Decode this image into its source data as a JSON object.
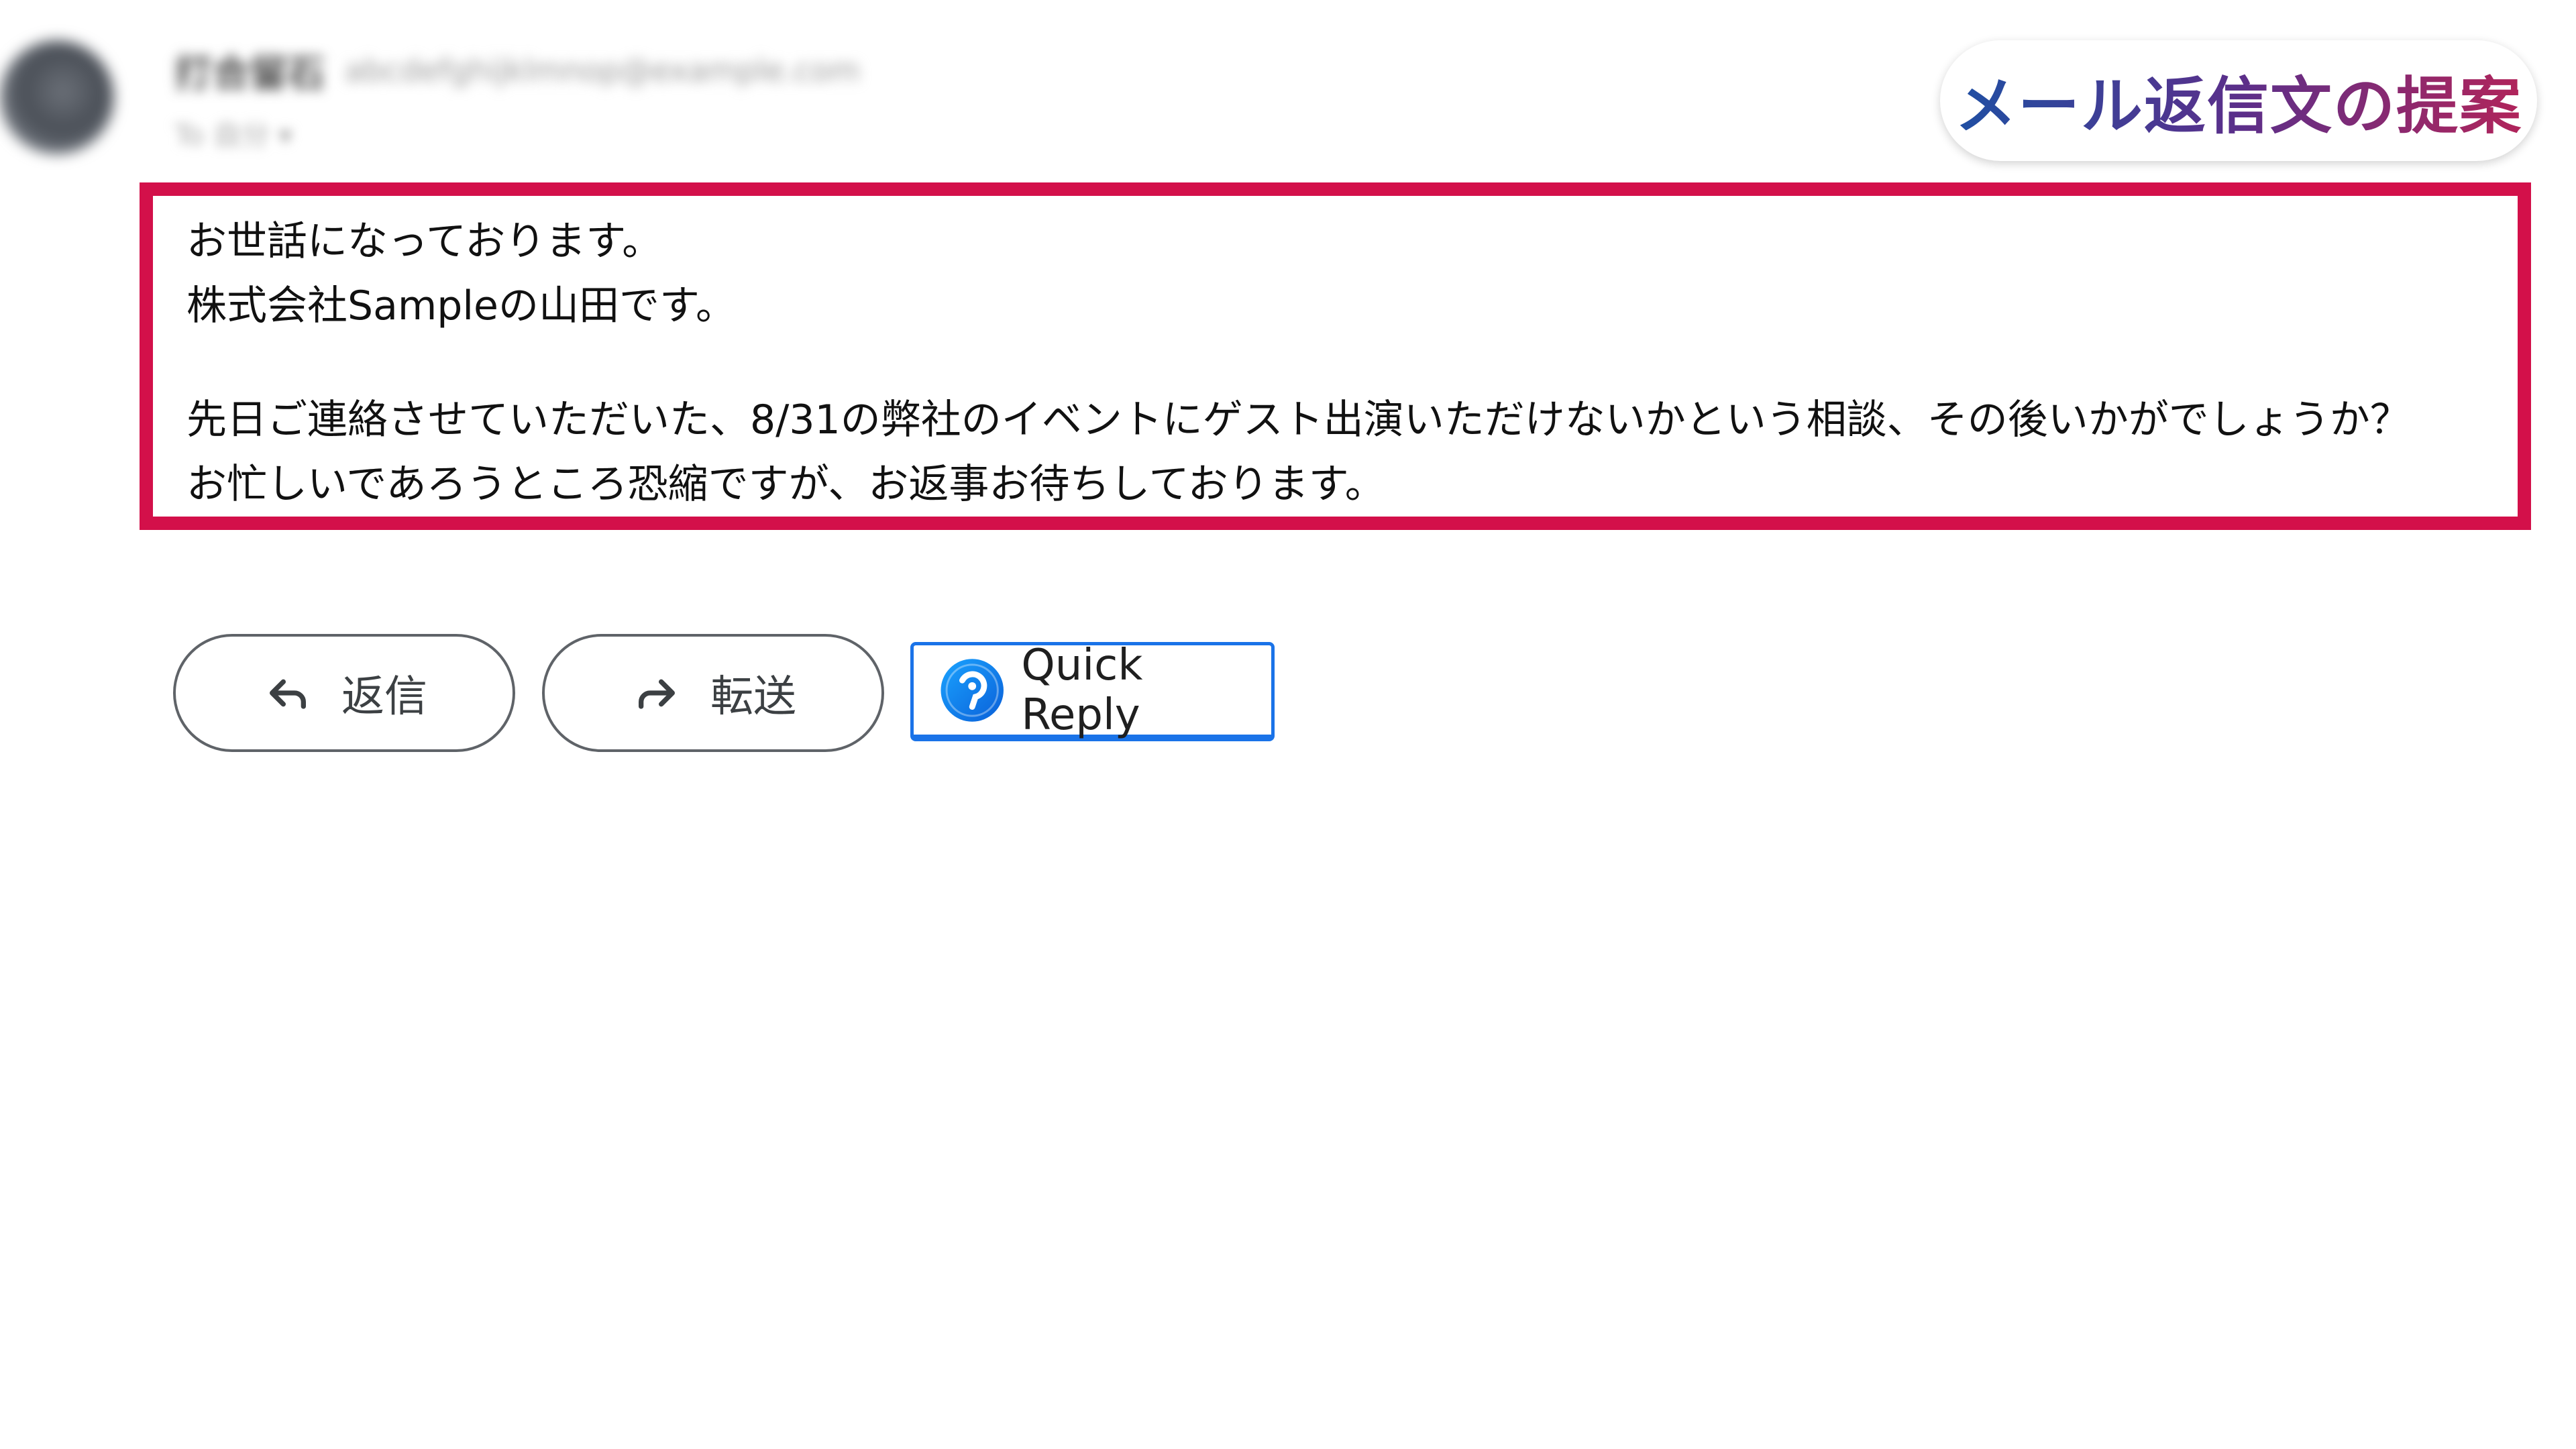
{
  "header": {
    "title": "メール返信文の提案",
    "sender_name": "打合留石",
    "sender_email": "abcdefghijklmnop@example.com",
    "sender_to": "To 自分 ▾"
  },
  "message": {
    "lines": [
      "お世話になっております。",
      "株式会社Sampleの山田です。",
      "",
      "先日ご連絡させていただいた、8/31の弊社のイベントにゲスト出演いただけないかという相談、その後いかがでしょうか？",
      "お忙しいであろうところ恐縮ですが、お返事お待ちしております。"
    ]
  },
  "actions": {
    "reply_label": "返信",
    "forward_label": "転送",
    "quick_reply_label": "Quick Reply"
  },
  "colors": {
    "highlight_border": "#d3104a",
    "quick_reply_border": "#1a73e8",
    "title_gradient_start": "#1f4fa3",
    "title_gradient_end": "#b1245a"
  },
  "icons": {
    "reply": "reply-arrow-icon",
    "forward": "forward-arrow-icon",
    "quick_reply": "quick-reply-logo-icon"
  }
}
